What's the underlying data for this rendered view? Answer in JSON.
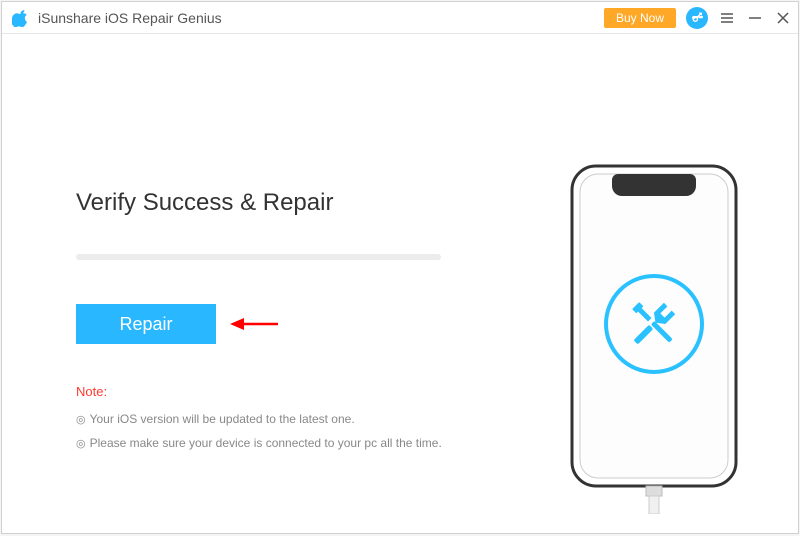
{
  "titlebar": {
    "app_title": "iSunshare iOS Repair Genius",
    "buy_label": "Buy Now"
  },
  "main": {
    "heading": "Verify Success & Repair",
    "repair_label": "Repair"
  },
  "notes": {
    "label": "Note:",
    "line1": "Your iOS version will be updated to the latest one.",
    "line2": "Please make sure your device is connected to your pc all the time."
  }
}
